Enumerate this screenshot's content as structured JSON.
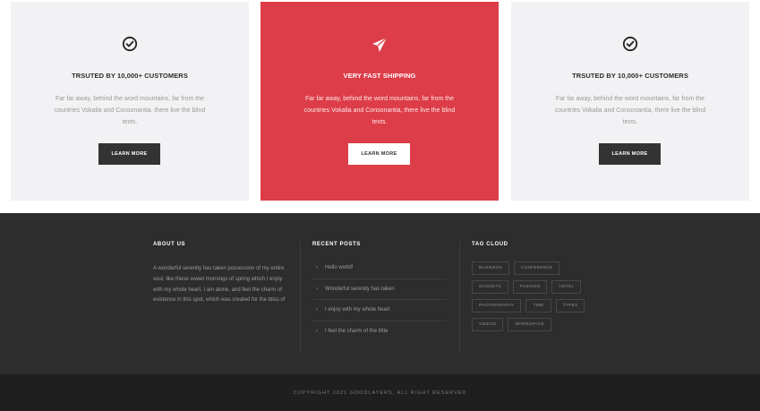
{
  "features": [
    {
      "icon": "check-circle-icon",
      "title": "TRSUTED BY 10,000+ CUSTOMERS",
      "text": "Far far away, behind the word mountains, far from the countries Vokalia and Consonantia, there live the blind texts.",
      "button": "LEARN MORE"
    },
    {
      "icon": "paper-plane-icon",
      "title": "VERY FAST SHIPPING",
      "text": "Far far away, behind the word mountains, far from the countries Vokalia and Consonantia, there live the blind texts.",
      "button": "LEARN MORE"
    },
    {
      "icon": "check-circle-icon",
      "title": "TRSUTED BY 10,000+ CUSTOMERS",
      "text": "Far far away, behind the word mountains, far from the countries Vokalia and Consonantia, there live the blind texts.",
      "button": "LEARN MORE"
    }
  ],
  "footer": {
    "about": {
      "title": "ABOUT US",
      "text": "A wonderful serenity has taken possession of my entire soul, like these sweet mornings of spring which I enjoy with my whole heart. I am alone, and feel the charm of existence in this spot, which was created for the bliss of"
    },
    "recent_posts": {
      "title": "RECENT POSTS",
      "items": [
        "Hello world!",
        "Wonderful serenity has taken",
        "I enjoy with my whole heart",
        "I feel the charm of the little"
      ]
    },
    "tag_cloud": {
      "title": "TAG CLOUD",
      "tags": [
        "BUSINESS",
        "CONFERENCE",
        "GADGETS",
        "FASHION",
        "HOTEL",
        "PHOTOGRAPHY",
        "TIME",
        "TYPES",
        "VIDEOS",
        "WORKSPACE"
      ]
    }
  },
  "copyright": "COPYRIGHT 2021 GOODLAYERS, ALL RIGHT RESERVED",
  "colors": {
    "accent": "#dc3d48",
    "card_bg": "#f2f1f3",
    "footer_bg": "#2d2d2d",
    "bottom_bar_bg": "#1f1f1f",
    "button_dark": "#333333"
  }
}
